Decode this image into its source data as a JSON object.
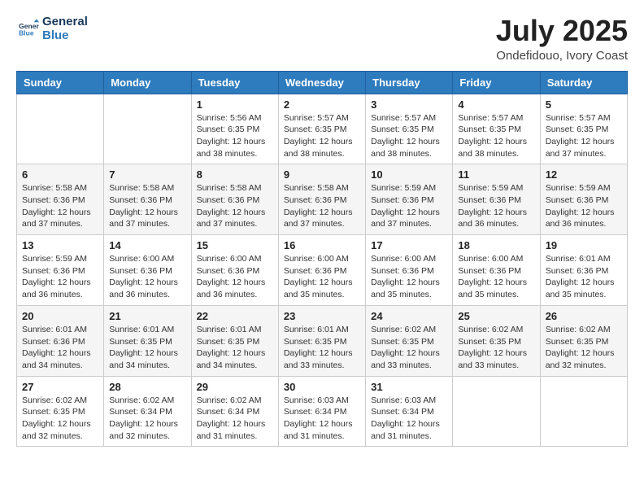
{
  "header": {
    "logo_line1": "General",
    "logo_line2": "Blue",
    "month_year": "July 2025",
    "location": "Ondefidouo, Ivory Coast"
  },
  "weekdays": [
    "Sunday",
    "Monday",
    "Tuesday",
    "Wednesday",
    "Thursday",
    "Friday",
    "Saturday"
  ],
  "weeks": [
    [
      {
        "day": "",
        "info": ""
      },
      {
        "day": "",
        "info": ""
      },
      {
        "day": "1",
        "info": "Sunrise: 5:56 AM\nSunset: 6:35 PM\nDaylight: 12 hours and 38 minutes."
      },
      {
        "day": "2",
        "info": "Sunrise: 5:57 AM\nSunset: 6:35 PM\nDaylight: 12 hours and 38 minutes."
      },
      {
        "day": "3",
        "info": "Sunrise: 5:57 AM\nSunset: 6:35 PM\nDaylight: 12 hours and 38 minutes."
      },
      {
        "day": "4",
        "info": "Sunrise: 5:57 AM\nSunset: 6:35 PM\nDaylight: 12 hours and 38 minutes."
      },
      {
        "day": "5",
        "info": "Sunrise: 5:57 AM\nSunset: 6:35 PM\nDaylight: 12 hours and 37 minutes."
      }
    ],
    [
      {
        "day": "6",
        "info": "Sunrise: 5:58 AM\nSunset: 6:36 PM\nDaylight: 12 hours and 37 minutes."
      },
      {
        "day": "7",
        "info": "Sunrise: 5:58 AM\nSunset: 6:36 PM\nDaylight: 12 hours and 37 minutes."
      },
      {
        "day": "8",
        "info": "Sunrise: 5:58 AM\nSunset: 6:36 PM\nDaylight: 12 hours and 37 minutes."
      },
      {
        "day": "9",
        "info": "Sunrise: 5:58 AM\nSunset: 6:36 PM\nDaylight: 12 hours and 37 minutes."
      },
      {
        "day": "10",
        "info": "Sunrise: 5:59 AM\nSunset: 6:36 PM\nDaylight: 12 hours and 37 minutes."
      },
      {
        "day": "11",
        "info": "Sunrise: 5:59 AM\nSunset: 6:36 PM\nDaylight: 12 hours and 36 minutes."
      },
      {
        "day": "12",
        "info": "Sunrise: 5:59 AM\nSunset: 6:36 PM\nDaylight: 12 hours and 36 minutes."
      }
    ],
    [
      {
        "day": "13",
        "info": "Sunrise: 5:59 AM\nSunset: 6:36 PM\nDaylight: 12 hours and 36 minutes."
      },
      {
        "day": "14",
        "info": "Sunrise: 6:00 AM\nSunset: 6:36 PM\nDaylight: 12 hours and 36 minutes."
      },
      {
        "day": "15",
        "info": "Sunrise: 6:00 AM\nSunset: 6:36 PM\nDaylight: 12 hours and 36 minutes."
      },
      {
        "day": "16",
        "info": "Sunrise: 6:00 AM\nSunset: 6:36 PM\nDaylight: 12 hours and 35 minutes."
      },
      {
        "day": "17",
        "info": "Sunrise: 6:00 AM\nSunset: 6:36 PM\nDaylight: 12 hours and 35 minutes."
      },
      {
        "day": "18",
        "info": "Sunrise: 6:00 AM\nSunset: 6:36 PM\nDaylight: 12 hours and 35 minutes."
      },
      {
        "day": "19",
        "info": "Sunrise: 6:01 AM\nSunset: 6:36 PM\nDaylight: 12 hours and 35 minutes."
      }
    ],
    [
      {
        "day": "20",
        "info": "Sunrise: 6:01 AM\nSunset: 6:36 PM\nDaylight: 12 hours and 34 minutes."
      },
      {
        "day": "21",
        "info": "Sunrise: 6:01 AM\nSunset: 6:35 PM\nDaylight: 12 hours and 34 minutes."
      },
      {
        "day": "22",
        "info": "Sunrise: 6:01 AM\nSunset: 6:35 PM\nDaylight: 12 hours and 34 minutes."
      },
      {
        "day": "23",
        "info": "Sunrise: 6:01 AM\nSunset: 6:35 PM\nDaylight: 12 hours and 33 minutes."
      },
      {
        "day": "24",
        "info": "Sunrise: 6:02 AM\nSunset: 6:35 PM\nDaylight: 12 hours and 33 minutes."
      },
      {
        "day": "25",
        "info": "Sunrise: 6:02 AM\nSunset: 6:35 PM\nDaylight: 12 hours and 33 minutes."
      },
      {
        "day": "26",
        "info": "Sunrise: 6:02 AM\nSunset: 6:35 PM\nDaylight: 12 hours and 32 minutes."
      }
    ],
    [
      {
        "day": "27",
        "info": "Sunrise: 6:02 AM\nSunset: 6:35 PM\nDaylight: 12 hours and 32 minutes."
      },
      {
        "day": "28",
        "info": "Sunrise: 6:02 AM\nSunset: 6:34 PM\nDaylight: 12 hours and 32 minutes."
      },
      {
        "day": "29",
        "info": "Sunrise: 6:02 AM\nSunset: 6:34 PM\nDaylight: 12 hours and 31 minutes."
      },
      {
        "day": "30",
        "info": "Sunrise: 6:03 AM\nSunset: 6:34 PM\nDaylight: 12 hours and 31 minutes."
      },
      {
        "day": "31",
        "info": "Sunrise: 6:03 AM\nSunset: 6:34 PM\nDaylight: 12 hours and 31 minutes."
      },
      {
        "day": "",
        "info": ""
      },
      {
        "day": "",
        "info": ""
      }
    ]
  ]
}
